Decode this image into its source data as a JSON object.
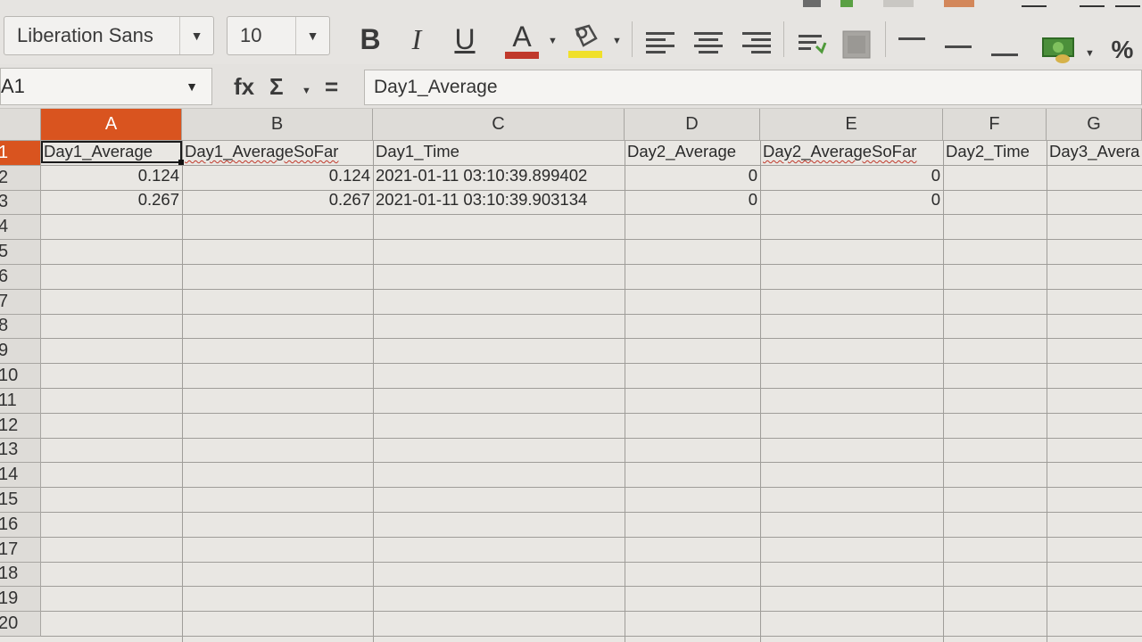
{
  "toolbar": {
    "font_name": "Liberation Sans",
    "font_size": "10",
    "bold": "B",
    "italic": "I",
    "underline": "U",
    "font_color_glyph": "A",
    "font_color": "#c0392b",
    "highlight_color": "#f0e02a",
    "percent": "%"
  },
  "formula_bar": {
    "cell_ref": "A1",
    "fx": "fx",
    "sigma": "Σ",
    "equals": "=",
    "content": "Day1_Average"
  },
  "columns": [
    {
      "letter": "A",
      "header": "Day1_Average"
    },
    {
      "letter": "B",
      "header": "Day1_AverageSoFar"
    },
    {
      "letter": "C",
      "header": "Day1_Time"
    },
    {
      "letter": "D",
      "header": "Day2_Average"
    },
    {
      "letter": "E",
      "header": "Day2_AverageSoFar"
    },
    {
      "letter": "F",
      "header": "Day2_Time"
    },
    {
      "letter": "G",
      "header": "Day3_Avera"
    }
  ],
  "rows": [
    {
      "a": "0.124",
      "b": "0.124",
      "c": "2021-01-11 03:10:39.899402",
      "d": "0",
      "e": "0"
    },
    {
      "a": "0.267",
      "b": "0.267",
      "c": "2021-01-11 03:10:39.903134",
      "d": "0",
      "e": "0"
    }
  ],
  "row_numbers": [
    "1",
    "2",
    "3",
    "4",
    "5",
    "6",
    "7",
    "8",
    "9",
    "10",
    "11",
    "12",
    "13",
    "14",
    "15",
    "16",
    "17",
    "18",
    "19",
    "20"
  ],
  "colors": {
    "active_header": "#d9541f"
  }
}
